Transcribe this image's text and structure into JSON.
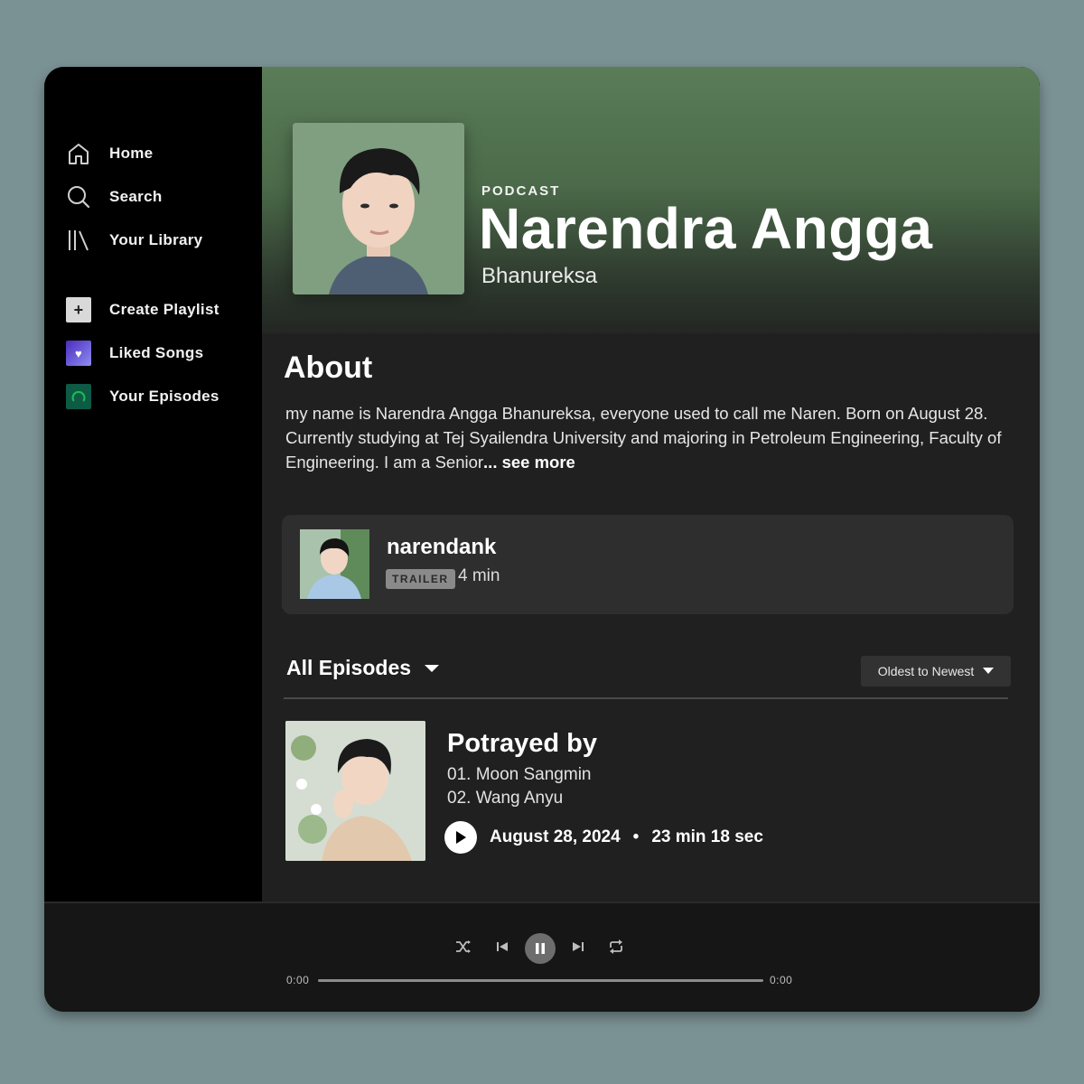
{
  "sidebar": {
    "nav": [
      {
        "label": "Home",
        "icon": "home-icon"
      },
      {
        "label": "Search",
        "icon": "search-icon"
      },
      {
        "label": "Your Library",
        "icon": "library-icon"
      }
    ],
    "playlists": [
      {
        "label": "Create Playlist",
        "icon": "plus-icon"
      },
      {
        "label": "Liked Songs",
        "icon": "heart-icon"
      },
      {
        "label": "Your Episodes",
        "icon": "episodes-icon"
      }
    ]
  },
  "header": {
    "kicker": "PODCAST",
    "title": "Narendra Angga",
    "subtitle": "Bhanureksa"
  },
  "about": {
    "heading": "About",
    "text": "my name is Narendra Angga Bhanureksa, everyone used to call me Naren. Born on August 28. Currently studying at Tej Syailendra University and majoring in Petroleum Engineering, Faculty of Engineering. I am a Senior",
    "more_label": "... see more"
  },
  "trailer": {
    "name": "narendank",
    "badge": "TRAILER",
    "duration": "4 min"
  },
  "episodes": {
    "filter_label": "All Episodes",
    "sort_label": "Oldest to Newest",
    "items": [
      {
        "title": "Potrayed by",
        "lines": [
          "01. Moon Sangmin",
          "02. Wang Anyu"
        ],
        "date": "August 28, 2024",
        "separator": "•",
        "duration": "23 min 18 sec"
      }
    ]
  },
  "player": {
    "time_elapsed": "0:00",
    "time_total": "0:00",
    "progress": 0
  },
  "colors": {
    "hero": "#5a7d58",
    "main_bg": "#202020",
    "card_bg": "#2e2e2e",
    "page_bg": "#7b9295"
  }
}
